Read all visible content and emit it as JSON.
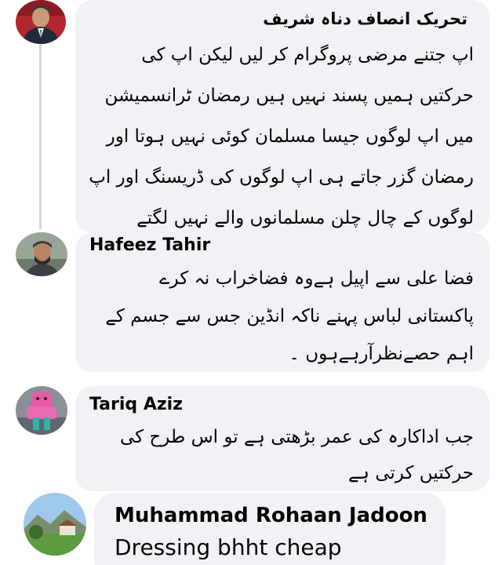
{
  "comments": [
    {
      "author": "تحریک انصاف دناہ شریف",
      "text_lines": [
        "اپ جتنے مرضی پروگرام کر لیں لیکن اپ کی",
        "حرکتیں ہمیں پسند نہیں ہیں رمضان ٹرانسمیشن",
        "میں اپ لوگوں جیسا مسلمان کوئی نہیں ہوتا اور",
        "رمضان گزر جاتے ہی اپ لوگوں کی ڈریسنگ اور اپ",
        "لوگوں کے چال چلن مسلمانوں والے نہیں لگتے"
      ],
      "avatar_icon": "profile-photo-man-suit"
    },
    {
      "author": "Hafeez Tahir",
      "text_lines": [
        "فضا علی سے اپیل ہےوہ فضاخراب نہ کرے",
        "پاکستانی لباس پہنے ناکہ انڈین جس سے جسم کے",
        "اہم حصےنظرآرہےہوں ۔"
      ],
      "avatar_icon": "profile-photo-man-cap"
    },
    {
      "author": "Tariq Aziz",
      "text_lines": [
        "جب اداکارہ کی عمر بڑھتی ہے تو اس طرح کی",
        "حرکتیں کرتی ہے"
      ],
      "avatar_icon": "profile-photo-pink-toy"
    },
    {
      "author": "Muhammad Rohaan Jadoon",
      "text_lines": [
        "Dressing bhht cheap"
      ],
      "avatar_icon": "profile-photo-landscape"
    }
  ],
  "colors": {
    "bubble": "#f0f2f5",
    "text": "#050505",
    "thread_line": "#d4d6da"
  }
}
